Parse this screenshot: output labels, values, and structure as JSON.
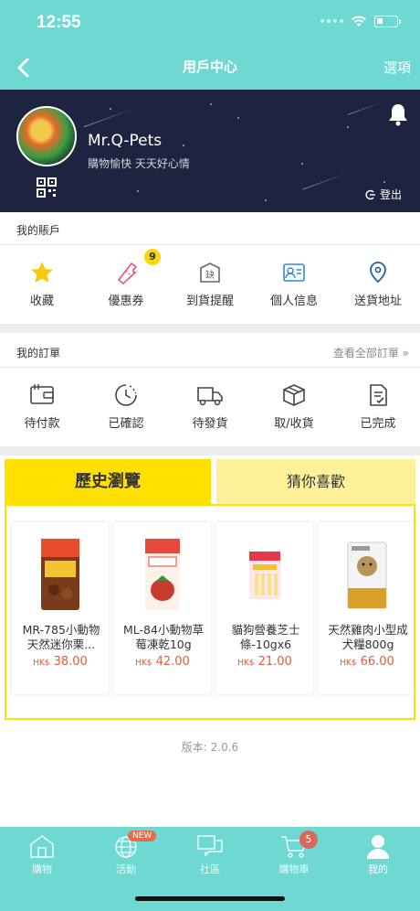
{
  "status": {
    "time": "12:55"
  },
  "nav": {
    "title": "用戶中心",
    "options_label": "選項"
  },
  "profile": {
    "username": "Mr.Q-Pets",
    "tagline": "購物愉快 天天好心情",
    "logout_label": "登出"
  },
  "account": {
    "title": "我的賬戶",
    "items": [
      {
        "label": "收藏",
        "icon": "star-icon"
      },
      {
        "label": "優惠券",
        "icon": "coupon-icon",
        "badge": "9"
      },
      {
        "label": "到貨提醒",
        "icon": "restock-icon"
      },
      {
        "label": "個人信息",
        "icon": "id-card-icon"
      },
      {
        "label": "送貨地址",
        "icon": "location-pin-icon"
      }
    ]
  },
  "orders": {
    "title": "我的訂單",
    "view_all": "查看全部訂單  »",
    "items": [
      {
        "label": "待付款",
        "icon": "wallet-icon"
      },
      {
        "label": "已確認",
        "icon": "clock-icon"
      },
      {
        "label": "待發貨",
        "icon": "truck-icon"
      },
      {
        "label": "取/收貨",
        "icon": "package-icon"
      },
      {
        "label": "已完成",
        "icon": "document-check-icon"
      }
    ]
  },
  "tabs": {
    "history": "歷史瀏覽",
    "recommend": "猜你喜歡"
  },
  "products": [
    {
      "name": "MR-785小動物天然迷你栗...",
      "currency": "HK$",
      "price": "38.00"
    },
    {
      "name": "ML-84小動物草莓凍乾10g",
      "currency": "HK$",
      "price": "42.00"
    },
    {
      "name": "貓狗營養芝士條-10gx6",
      "currency": "HK$",
      "price": "21.00"
    },
    {
      "name": "天然雞肉小型成犬糧800g",
      "currency": "HK$",
      "price": "66.00"
    }
  ],
  "version_text": "版本: 2.0.6",
  "bottom_nav": {
    "items": [
      {
        "label": "購物",
        "icon": "shop-icon"
      },
      {
        "label": "活動",
        "icon": "globe-icon",
        "badge": "NEW"
      },
      {
        "label": "社區",
        "icon": "chat-icon"
      },
      {
        "label": "購物車",
        "icon": "cart-icon",
        "badge": "5"
      },
      {
        "label": "我的",
        "icon": "user-icon",
        "active": true
      }
    ]
  },
  "colors": {
    "accent": "#6ED9D3",
    "tab_active": "#FFE000",
    "tab_inactive": "#FEF19A",
    "price": "#E95A3B",
    "banner": "#1E2440"
  }
}
